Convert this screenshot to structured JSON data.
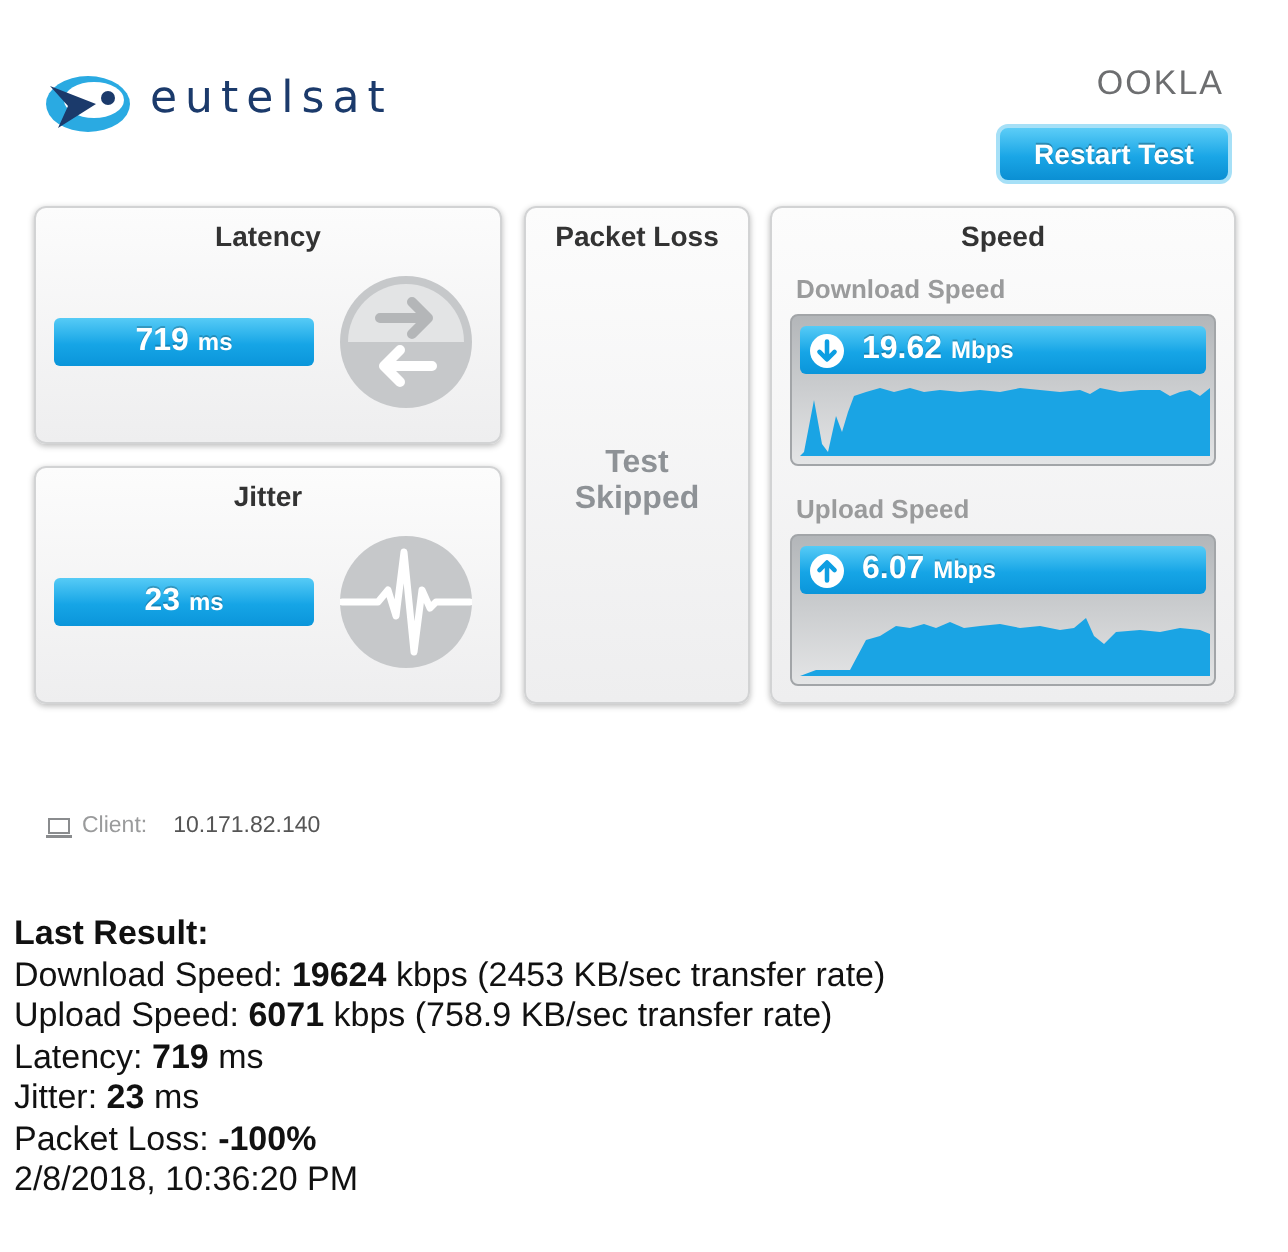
{
  "header": {
    "brand": "eutelsat",
    "partner_logo": "OOKLA",
    "restart_button": "Restart Test"
  },
  "metrics": [
    {
      "kind": "latency",
      "title": "Latency",
      "value": "719",
      "unit": "ms"
    },
    {
      "kind": "jitter",
      "title": "Jitter",
      "value": "23",
      "unit": "ms"
    }
  ],
  "packet_loss": {
    "title": "Packet Loss",
    "status": "Test Skipped"
  },
  "speed": {
    "title": "Speed",
    "tests": [
      {
        "kind": "download",
        "label": "Download Speed",
        "value": "19.62",
        "unit": "Mbps"
      },
      {
        "kind": "upload",
        "label": "Upload Speed",
        "value": "6.07",
        "unit": "Mbps"
      }
    ]
  },
  "client": {
    "label": "Client:",
    "address": "10.171.82.140"
  },
  "last_result": {
    "heading": "Last Result:",
    "lines": [
      "Download Speed: **19624** kbps (2453 KB/sec transfer rate)",
      "Upload Speed: **6071** kbps (758.9 KB/sec transfer rate)",
      "Latency: **719** ms",
      "Jitter: **23** ms",
      "Packet Loss: **-100%**",
      "2/8/2018, 10:36:20 PM"
    ]
  }
}
